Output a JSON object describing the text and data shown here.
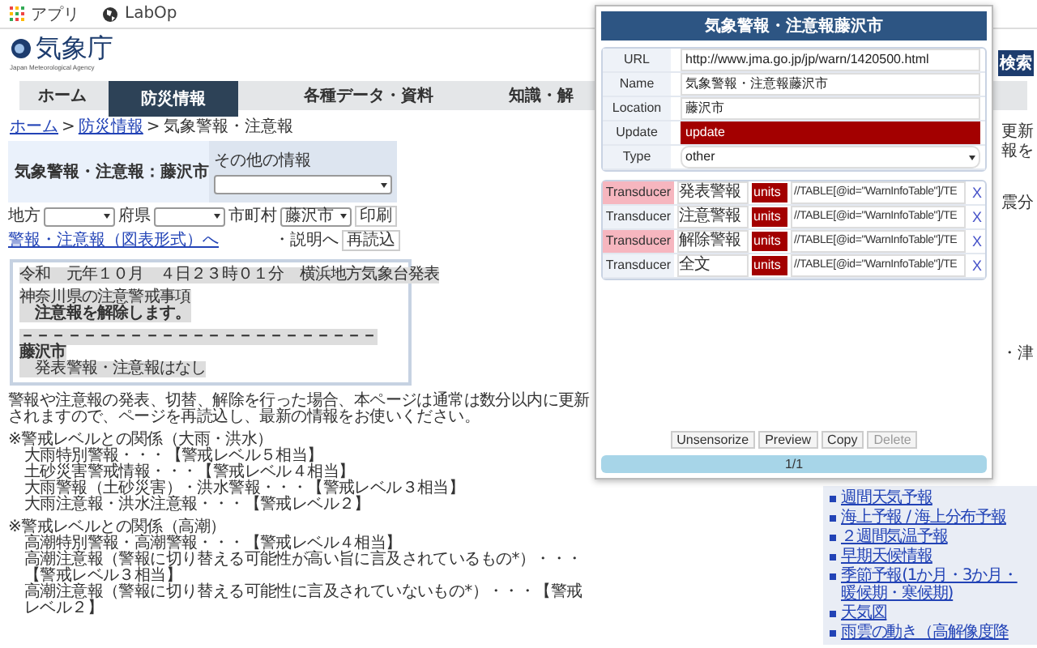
{
  "bookmarks": [
    {
      "label": "アプリ",
      "kind": "apps"
    },
    {
      "label": "LabOp",
      "kind": "globe"
    }
  ],
  "site": {
    "logo_text": "気象庁",
    "logo_subtitle": "Japan Meteorological Agency",
    "search_button": "検索"
  },
  "nav": [
    {
      "label": "ホーム",
      "selected": false
    },
    {
      "label": "防災情報",
      "selected": true
    },
    {
      "label": "各種データ・資料",
      "selected": false
    },
    {
      "label": "知識・解",
      "selected": false
    }
  ],
  "breadcrumb": {
    "separator": ">",
    "items": [
      {
        "label": "ホーム",
        "link": true
      },
      {
        "label": "防災情報",
        "link": true
      },
      {
        "label": "気象警報・注意報",
        "link": false
      }
    ]
  },
  "title_panel": {
    "title": "気象警報・注意報：藤沢市",
    "other_label": "その他の情報"
  },
  "filters": [
    {
      "label": "地方"
    },
    {
      "label": "府県"
    },
    {
      "label": "市町村",
      "value": "藤沢市"
    }
  ],
  "print_button": "印刷",
  "table_link": "警報・注意報（図表形式）へ",
  "explain_link": "・説明へ",
  "reload_button": "再読込",
  "bulletin": [
    {
      "text": "令和　元年１０月　４日２３時０１分　横浜地方気象台発表",
      "bold": false
    },
    {
      "text": "神奈川県の注意警戒事項",
      "bold": false
    },
    {
      "text": "　注意報を解除します。",
      "bold": true
    },
    {
      "text": "－－－－－－－－－－－－－－－－－－－－－－－",
      "bold": true
    },
    {
      "text": "藤沢市",
      "bold": true
    },
    {
      "text": "　発表警報・注意報はなし",
      "bold": false
    }
  ],
  "notice": "警報や注意報の発表、切替、解除を行った場合、本ページは通常は数分以内に更新されますので、ページを再読込し、最新の情報をお使いください。",
  "levels": [
    {
      "title": "※警戒レベルとの関係（大雨・洪水）",
      "lines": [
        "大雨特別警報・・・【警戒レベル５相当】",
        "土砂災害警戒情報・・・【警戒レベル４相当】",
        "大雨警報（土砂災害）・洪水警報・・・【警戒レベル３相当】",
        "大雨注意報・洪水注意報・・・【警戒レベル２】"
      ]
    },
    {
      "title": "※警戒レベルとの関係（高潮）",
      "lines": [
        "高潮特別警報・高潮警報・・・【警戒レベル４相当】",
        "高潮注意報（警報に切り替える可能性が高い旨に言及されているもの*）・・・【警戒レベル３相当】",
        "高潮注意報（警報に切り替える可能性に言及されていないもの*）・・・【警戒レベル２】"
      ]
    }
  ],
  "side_fragments": [
    "更新",
    "報を",
    "震分",
    "・津"
  ],
  "side_links": [
    "週間天気予報",
    "海上予報 / 海上分布予報",
    "２週間気温予報",
    "早期天候情報",
    "季節予報(1か月・3か月・暖候期・寒候期)",
    "天気図",
    "雨雲の動き（高解像度降"
  ],
  "popup": {
    "title": "気象警報・注意報藤沢市",
    "fields": [
      {
        "label": "URL",
        "value": "http://www.jma.go.jp/jp/warn/1420500.html",
        "kind": "text"
      },
      {
        "label": "Name",
        "value": "気象警報・注意報藤沢市",
        "kind": "text"
      },
      {
        "label": "Location",
        "value": "藤沢市",
        "kind": "text"
      },
      {
        "label": "Update",
        "value": "update",
        "kind": "error"
      },
      {
        "label": "Type",
        "value": "other",
        "kind": "select"
      }
    ],
    "transducers": [
      {
        "label": "Transducer",
        "highlighted": true,
        "name": "発表警報",
        "units": "units",
        "path": "//TABLE[@id=\"WarnInfoTable\"]/TE",
        "remove": "X"
      },
      {
        "label": "Transducer",
        "highlighted": false,
        "name": "注意警報",
        "units": "units",
        "path": "//TABLE[@id=\"WarnInfoTable\"]/TE",
        "remove": "X"
      },
      {
        "label": "Transducer",
        "highlighted": true,
        "name": "解除警報",
        "units": "units",
        "path": "//TABLE[@id=\"WarnInfoTable\"]/TE",
        "remove": "X"
      },
      {
        "label": "Transducer",
        "highlighted": false,
        "name": "全文",
        "units": "units",
        "path": "//TABLE[@id=\"WarnInfoTable\"]/TE",
        "remove": "X"
      }
    ],
    "buttons": [
      {
        "label": "Unsensorize",
        "disabled": false
      },
      {
        "label": "Preview",
        "disabled": false
      },
      {
        "label": "Copy",
        "disabled": false
      },
      {
        "label": "Delete",
        "disabled": true
      }
    ],
    "pager": "1/1"
  }
}
